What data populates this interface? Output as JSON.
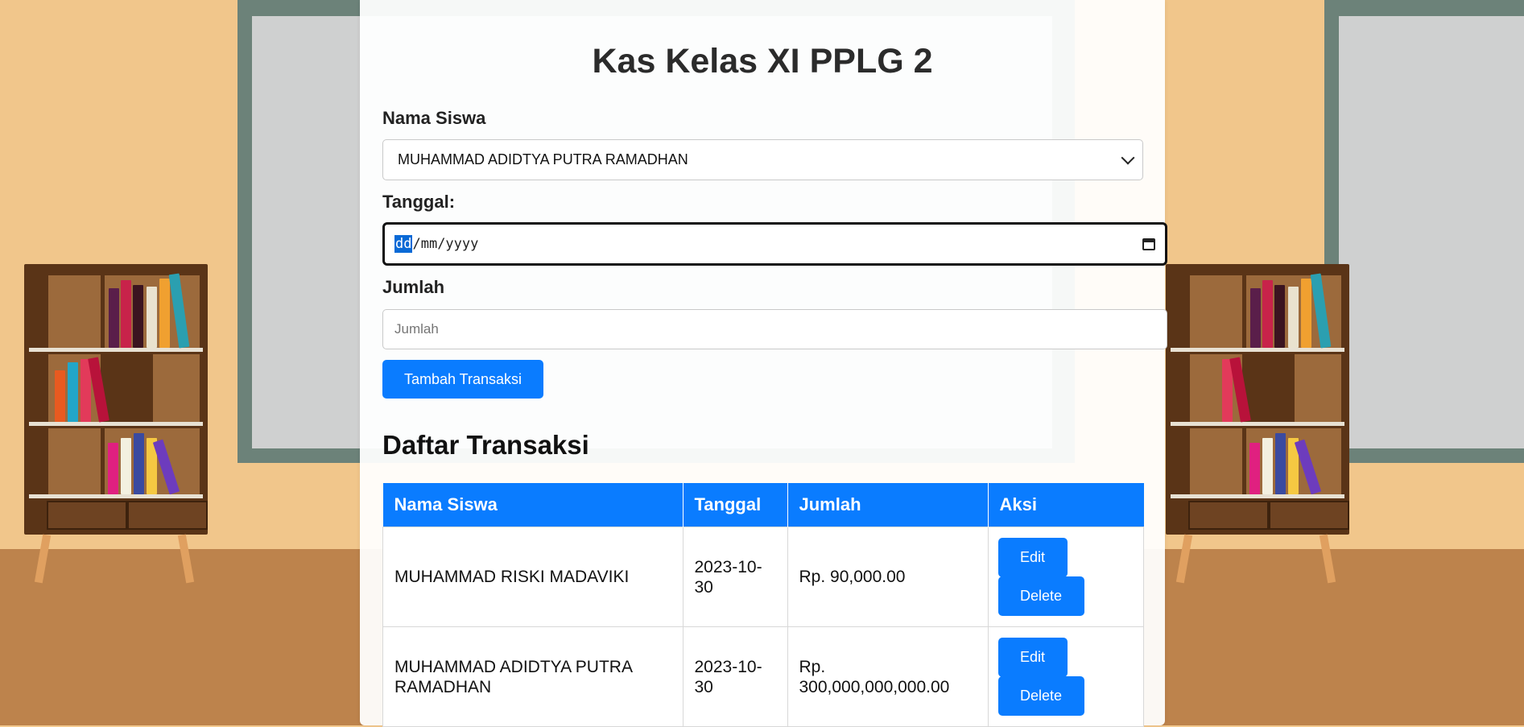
{
  "page": {
    "title": "Kas Kelas XI PPLG 2"
  },
  "form": {
    "student_label": "Nama Siswa",
    "student_selected": "MUHAMMAD ADIDTYA PUTRA RAMADHAN",
    "date_label": "Tanggal:",
    "date_placeholder_day": "dd",
    "date_placeholder_rest": "/mm/yyyy",
    "amount_label": "Jumlah",
    "amount_placeholder": "Jumlah",
    "submit_label": "Tambah Transaksi"
  },
  "transactions": {
    "title": "Daftar Transaksi",
    "columns": [
      "Nama Siswa",
      "Tanggal",
      "Jumlah",
      "Aksi"
    ],
    "rows": [
      {
        "name": "MUHAMMAD RISKI MADAVIKI",
        "date": "2023-10-30",
        "amount": "Rp. 90,000.00",
        "edit_label": "Edit",
        "delete_label": "Delete"
      },
      {
        "name": "MUHAMMAD ADIDTYA PUTRA RAMADHAN",
        "date": "2023-10-30",
        "amount": "Rp. 300,000,000,000.00",
        "edit_label": "Edit",
        "delete_label": "Delete"
      }
    ]
  },
  "colors": {
    "accent": "#0a7cff",
    "wall": "#f1c68b",
    "floor": "#bd834c",
    "board": "#6c8279"
  }
}
